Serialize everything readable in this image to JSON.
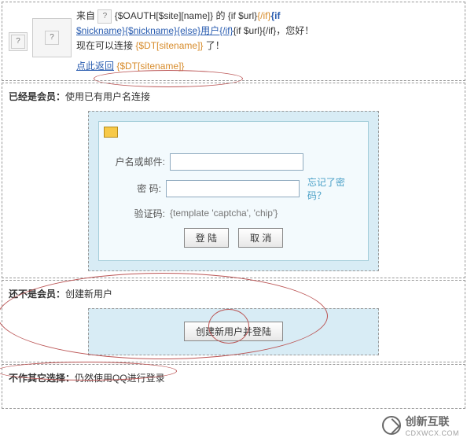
{
  "top": {
    "from": "来自",
    "oauth_var": "{$OAUTH[$site][name]}",
    "of": " 的 ",
    "if_url": "{if $url}",
    "endif": "{/if}",
    "if": "{if",
    "nick1": "$nickname}",
    "nick2": "{$nickname}",
    "else": "{else}",
    "user_label": "用户",
    "endif2": "{/if}",
    "if_url2": "{if $url}",
    "hello": "，您好！",
    "now_connect": "现在可以连接",
    "dt_site": "{$DT[sitename]}",
    "le": "了！",
    "return_prefix": "点此返回",
    "return_var": "{$DT[sitename]}"
  },
  "member": {
    "title": "已经是会员：",
    "sub": "使用已有用户名连接",
    "labels": {
      "username": "户名或邮件:",
      "password": "密 码:",
      "verify": "验证码:"
    },
    "forgot": "忘记了密码？",
    "verify_tpl": "{template 'captcha', 'chip'}",
    "btn_login": "登 陆",
    "btn_cancel": "取 消"
  },
  "notmember": {
    "title": "还不是会员：",
    "sub": "创建新用户",
    "btn": "创建新用户并登陆"
  },
  "noother": {
    "title": "不作其它选择：",
    "sub": "仍然使用QQ进行登录"
  },
  "watermark": {
    "cn": "创新互联",
    "en": "CDXWCX.COM"
  }
}
